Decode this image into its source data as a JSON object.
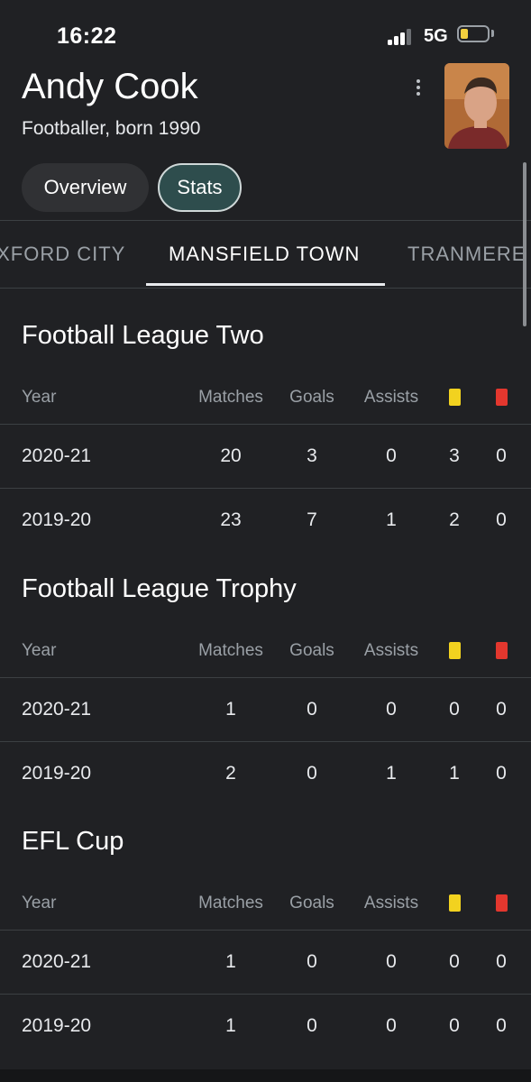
{
  "status_bar": {
    "time": "16:22",
    "network": "5G"
  },
  "header": {
    "name": "Andy Cook",
    "subtitle": "Footballer, born 1990"
  },
  "chips": [
    {
      "label": "Overview"
    },
    {
      "label": "Stats",
      "selected": true
    }
  ],
  "team_tabs": [
    {
      "label": "OXFORD CITY"
    },
    {
      "label": "MANSFIELD TOWN",
      "selected": true
    },
    {
      "label": "TRANMERE"
    }
  ],
  "table_headers": {
    "year": "Year",
    "matches": "Matches",
    "goals": "Goals",
    "assists": "Assists",
    "yellow_icon": "yellow-card-icon",
    "red_icon": "red-card-icon"
  },
  "sections": [
    {
      "title": "Football League Two",
      "rows": [
        {
          "year": "2020-21",
          "matches": "20",
          "goals": "3",
          "assists": "0",
          "yellow": "3",
          "red": "0"
        },
        {
          "year": "2019-20",
          "matches": "23",
          "goals": "7",
          "assists": "1",
          "yellow": "2",
          "red": "0"
        }
      ]
    },
    {
      "title": "Football League Trophy",
      "rows": [
        {
          "year": "2020-21",
          "matches": "1",
          "goals": "0",
          "assists": "0",
          "yellow": "0",
          "red": "0"
        },
        {
          "year": "2019-20",
          "matches": "2",
          "goals": "0",
          "assists": "1",
          "yellow": "1",
          "red": "0"
        }
      ]
    },
    {
      "title": "EFL Cup",
      "rows": [
        {
          "year": "2020-21",
          "matches": "1",
          "goals": "0",
          "assists": "0",
          "yellow": "0",
          "red": "0"
        },
        {
          "year": "2019-20",
          "matches": "1",
          "goals": "0",
          "assists": "0",
          "yellow": "0",
          "red": "0"
        }
      ]
    }
  ],
  "colors": {
    "background": "#202124",
    "accent_chip": "#2e4d4d",
    "yellow_card": "#f2d21f",
    "red_card": "#e3372e"
  }
}
